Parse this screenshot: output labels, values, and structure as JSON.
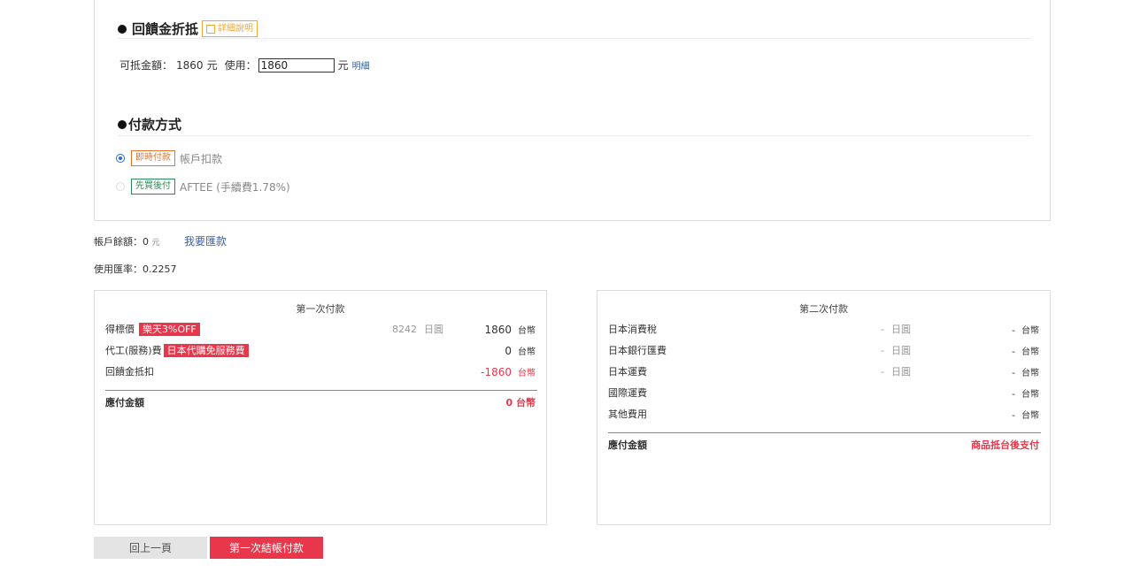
{
  "rebate": {
    "title": "回饋金折抵",
    "info_label": "詳細說明",
    "available_label": "可抵金額：",
    "available_amount": "1860",
    "unit": "元",
    "use_label": "使用：",
    "use_value": "1860",
    "detail_link": "明細"
  },
  "payment": {
    "title": "付款方式",
    "options": [
      {
        "tag": "即時付款",
        "label": "帳戶扣款",
        "selected": true
      },
      {
        "tag": "先買後付",
        "label": "AFTEE (手續費1.78%)",
        "selected": false
      }
    ]
  },
  "account": {
    "balance_label": "帳戶餘額：",
    "balance_value": "0",
    "balance_unit": "元",
    "remit_link": "我要匯款",
    "rate_label": "使用匯率：",
    "rate_value": "0.2257"
  },
  "first_payment": {
    "title": "第一次付款",
    "rows": [
      {
        "label": "得標價",
        "tag": "樂天3%OFF",
        "jpy": "8242",
        "jpy_unit": "日圓",
        "twd": "1860",
        "twd_unit": "台幣"
      },
      {
        "label": "代工(服務)費",
        "tag": "日本代購免服務費",
        "twd": "0",
        "twd_unit": "台幣"
      },
      {
        "label": "回饋金抵扣",
        "twd": "-1860",
        "twd_unit": "台幣"
      }
    ],
    "total_label": "應付金額",
    "total_value": "0 台幣"
  },
  "second_payment": {
    "title": "第二次付款",
    "rows": [
      {
        "label": "日本消費稅",
        "jpy": "-",
        "jpy_unit": "日圓",
        "twd": "-",
        "twd_unit": "台幣"
      },
      {
        "label": "日本銀行匯費",
        "jpy": "-",
        "jpy_unit": "日圓",
        "twd": "-",
        "twd_unit": "台幣"
      },
      {
        "label": "日本運費",
        "jpy": "-",
        "jpy_unit": "日圓",
        "twd": "-",
        "twd_unit": "台幣"
      },
      {
        "label": "國際運費",
        "twd": "-",
        "twd_unit": "台幣"
      },
      {
        "label": "其他費用",
        "twd": "-",
        "twd_unit": "台幣"
      }
    ],
    "total_label": "應付金額",
    "total_value": "商品抵台後支付"
  },
  "buttons": {
    "back": "回上一頁",
    "checkout": "第一次結帳付款"
  },
  "colors": {
    "accent": "#e8364a",
    "link": "#3a62a8",
    "orange": "#f0a830"
  }
}
